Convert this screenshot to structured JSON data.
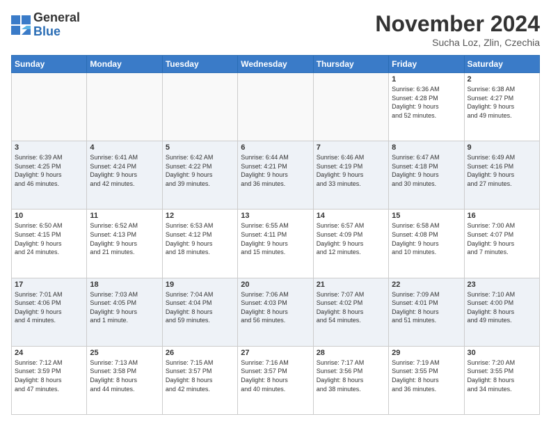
{
  "logo": {
    "general": "General",
    "blue": "Blue"
  },
  "title": "November 2024",
  "subtitle": "Sucha Loz, Zlin, Czechia",
  "headers": [
    "Sunday",
    "Monday",
    "Tuesday",
    "Wednesday",
    "Thursday",
    "Friday",
    "Saturday"
  ],
  "weeks": [
    [
      {
        "day": "",
        "info": ""
      },
      {
        "day": "",
        "info": ""
      },
      {
        "day": "",
        "info": ""
      },
      {
        "day": "",
        "info": ""
      },
      {
        "day": "",
        "info": ""
      },
      {
        "day": "1",
        "info": "Sunrise: 6:36 AM\nSunset: 4:28 PM\nDaylight: 9 hours\nand 52 minutes."
      },
      {
        "day": "2",
        "info": "Sunrise: 6:38 AM\nSunset: 4:27 PM\nDaylight: 9 hours\nand 49 minutes."
      }
    ],
    [
      {
        "day": "3",
        "info": "Sunrise: 6:39 AM\nSunset: 4:25 PM\nDaylight: 9 hours\nand 46 minutes."
      },
      {
        "day": "4",
        "info": "Sunrise: 6:41 AM\nSunset: 4:24 PM\nDaylight: 9 hours\nand 42 minutes."
      },
      {
        "day": "5",
        "info": "Sunrise: 6:42 AM\nSunset: 4:22 PM\nDaylight: 9 hours\nand 39 minutes."
      },
      {
        "day": "6",
        "info": "Sunrise: 6:44 AM\nSunset: 4:21 PM\nDaylight: 9 hours\nand 36 minutes."
      },
      {
        "day": "7",
        "info": "Sunrise: 6:46 AM\nSunset: 4:19 PM\nDaylight: 9 hours\nand 33 minutes."
      },
      {
        "day": "8",
        "info": "Sunrise: 6:47 AM\nSunset: 4:18 PM\nDaylight: 9 hours\nand 30 minutes."
      },
      {
        "day": "9",
        "info": "Sunrise: 6:49 AM\nSunset: 4:16 PM\nDaylight: 9 hours\nand 27 minutes."
      }
    ],
    [
      {
        "day": "10",
        "info": "Sunrise: 6:50 AM\nSunset: 4:15 PM\nDaylight: 9 hours\nand 24 minutes."
      },
      {
        "day": "11",
        "info": "Sunrise: 6:52 AM\nSunset: 4:13 PM\nDaylight: 9 hours\nand 21 minutes."
      },
      {
        "day": "12",
        "info": "Sunrise: 6:53 AM\nSunset: 4:12 PM\nDaylight: 9 hours\nand 18 minutes."
      },
      {
        "day": "13",
        "info": "Sunrise: 6:55 AM\nSunset: 4:11 PM\nDaylight: 9 hours\nand 15 minutes."
      },
      {
        "day": "14",
        "info": "Sunrise: 6:57 AM\nSunset: 4:09 PM\nDaylight: 9 hours\nand 12 minutes."
      },
      {
        "day": "15",
        "info": "Sunrise: 6:58 AM\nSunset: 4:08 PM\nDaylight: 9 hours\nand 10 minutes."
      },
      {
        "day": "16",
        "info": "Sunrise: 7:00 AM\nSunset: 4:07 PM\nDaylight: 9 hours\nand 7 minutes."
      }
    ],
    [
      {
        "day": "17",
        "info": "Sunrise: 7:01 AM\nSunset: 4:06 PM\nDaylight: 9 hours\nand 4 minutes."
      },
      {
        "day": "18",
        "info": "Sunrise: 7:03 AM\nSunset: 4:05 PM\nDaylight: 9 hours\nand 1 minute."
      },
      {
        "day": "19",
        "info": "Sunrise: 7:04 AM\nSunset: 4:04 PM\nDaylight: 8 hours\nand 59 minutes."
      },
      {
        "day": "20",
        "info": "Sunrise: 7:06 AM\nSunset: 4:03 PM\nDaylight: 8 hours\nand 56 minutes."
      },
      {
        "day": "21",
        "info": "Sunrise: 7:07 AM\nSunset: 4:02 PM\nDaylight: 8 hours\nand 54 minutes."
      },
      {
        "day": "22",
        "info": "Sunrise: 7:09 AM\nSunset: 4:01 PM\nDaylight: 8 hours\nand 51 minutes."
      },
      {
        "day": "23",
        "info": "Sunrise: 7:10 AM\nSunset: 4:00 PM\nDaylight: 8 hours\nand 49 minutes."
      }
    ],
    [
      {
        "day": "24",
        "info": "Sunrise: 7:12 AM\nSunset: 3:59 PM\nDaylight: 8 hours\nand 47 minutes."
      },
      {
        "day": "25",
        "info": "Sunrise: 7:13 AM\nSunset: 3:58 PM\nDaylight: 8 hours\nand 44 minutes."
      },
      {
        "day": "26",
        "info": "Sunrise: 7:15 AM\nSunset: 3:57 PM\nDaylight: 8 hours\nand 42 minutes."
      },
      {
        "day": "27",
        "info": "Sunrise: 7:16 AM\nSunset: 3:57 PM\nDaylight: 8 hours\nand 40 minutes."
      },
      {
        "day": "28",
        "info": "Sunrise: 7:17 AM\nSunset: 3:56 PM\nDaylight: 8 hours\nand 38 minutes."
      },
      {
        "day": "29",
        "info": "Sunrise: 7:19 AM\nSunset: 3:55 PM\nDaylight: 8 hours\nand 36 minutes."
      },
      {
        "day": "30",
        "info": "Sunrise: 7:20 AM\nSunset: 3:55 PM\nDaylight: 8 hours\nand 34 minutes."
      }
    ]
  ]
}
